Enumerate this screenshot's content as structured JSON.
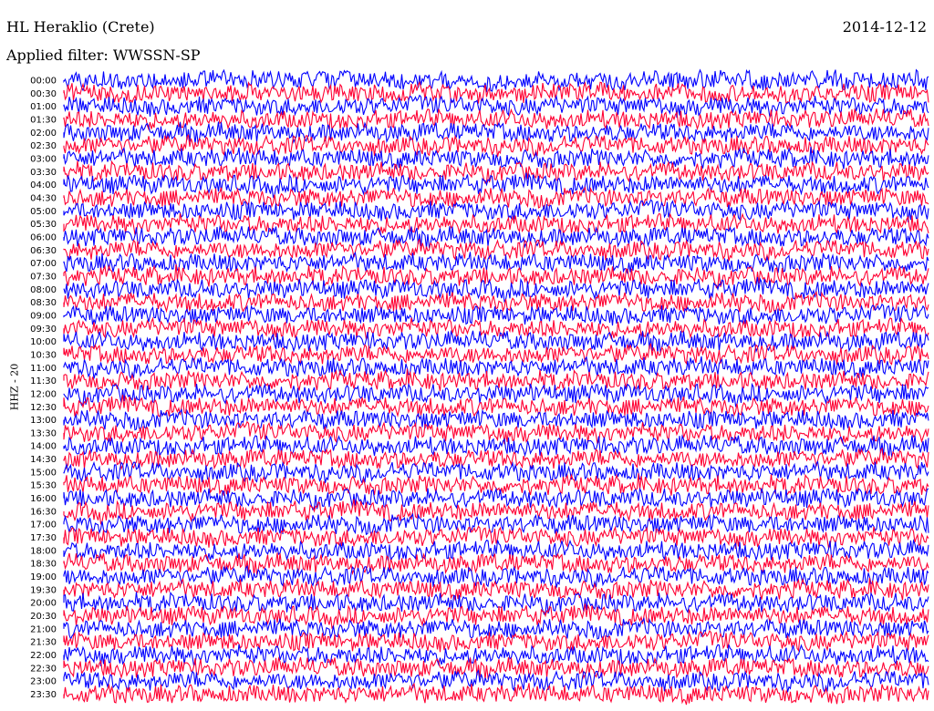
{
  "header": {
    "title": "HL Heraklio (Crete)",
    "date": "2014-12-12",
    "filter": "Applied filter: WWSSN-SP"
  },
  "chart_data": {
    "type": "line",
    "title": "HL Heraklio (Crete)",
    "ylabel": "HHZ - 20",
    "xlabel": "",
    "row_labels": [
      "00:00",
      "00:30",
      "01:00",
      "01:30",
      "02:00",
      "02:30",
      "03:00",
      "03:30",
      "04:00",
      "04:30",
      "05:00",
      "05:30",
      "06:00",
      "06:30",
      "07:00",
      "07:30",
      "08:00",
      "08:30",
      "09:00",
      "09:30",
      "10:00",
      "10:30",
      "11:00",
      "11:30",
      "12:00",
      "12:30",
      "13:00",
      "13:30",
      "14:00",
      "14:30",
      "15:00",
      "15:30",
      "16:00",
      "16:30",
      "17:00",
      "17:30",
      "18:00",
      "18:30",
      "19:00",
      "19:30",
      "20:00",
      "20:30",
      "21:00",
      "21:30",
      "22:00",
      "22:30",
      "23:00",
      "23:30"
    ],
    "series_colors": [
      "#0000ff",
      "#ff0033"
    ],
    "grid": false,
    "legend": "none"
  }
}
